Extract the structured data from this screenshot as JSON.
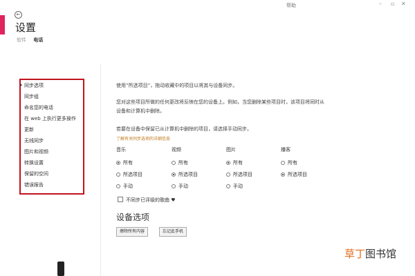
{
  "window": {
    "help_label": "帮助"
  },
  "header": {
    "title": "设置",
    "subtabs": [
      "软件",
      "电话"
    ]
  },
  "sidebar": {
    "items": [
      {
        "label": "同步选项"
      },
      {
        "label": "同步组"
      },
      {
        "label": "命名您的电话"
      },
      {
        "label": "在 web 上执行更多操作"
      },
      {
        "label": "更新"
      },
      {
        "label": "无线同步"
      },
      {
        "label": "图片和视频"
      },
      {
        "label": "转换设置"
      },
      {
        "label": "保留的空间"
      },
      {
        "label": "错误报告"
      }
    ]
  },
  "main": {
    "intro": "使用“所选项目”，拖动收藏中的项目以将其与设备同步。",
    "desc_line1": "您对这些项目所做的任何更改将反映在您的设备上。例如，当您删除某些项目时，该项目将同时从",
    "desc_line2": "设备和计算机中删除。",
    "manual_note": "若要在设备中保留已从计算机中删除的项目，请选择手动同步。",
    "link": "了解有关同步选项的详细信息",
    "columns": [
      {
        "label": "音乐",
        "options": [
          "所有",
          "所选项目",
          "手动"
        ],
        "selected": 0
      },
      {
        "label": "视频",
        "options": [
          "所有",
          "所选项目",
          "手动"
        ],
        "selected": 1
      },
      {
        "label": "图片",
        "options": [
          "所有",
          "所选项目",
          "手动"
        ],
        "selected": 0
      },
      {
        "label": "播客",
        "options": [
          "所有",
          "所选项目"
        ],
        "selected": 1
      }
    ],
    "checkbox_label": "不同步已评级的歌曲 ♥",
    "device_section_title": "设备选项",
    "buttons": [
      "擦除所有内容",
      "忘记此手机"
    ]
  },
  "watermark": {
    "part1": "草丁",
    "part2": "图书馆"
  }
}
